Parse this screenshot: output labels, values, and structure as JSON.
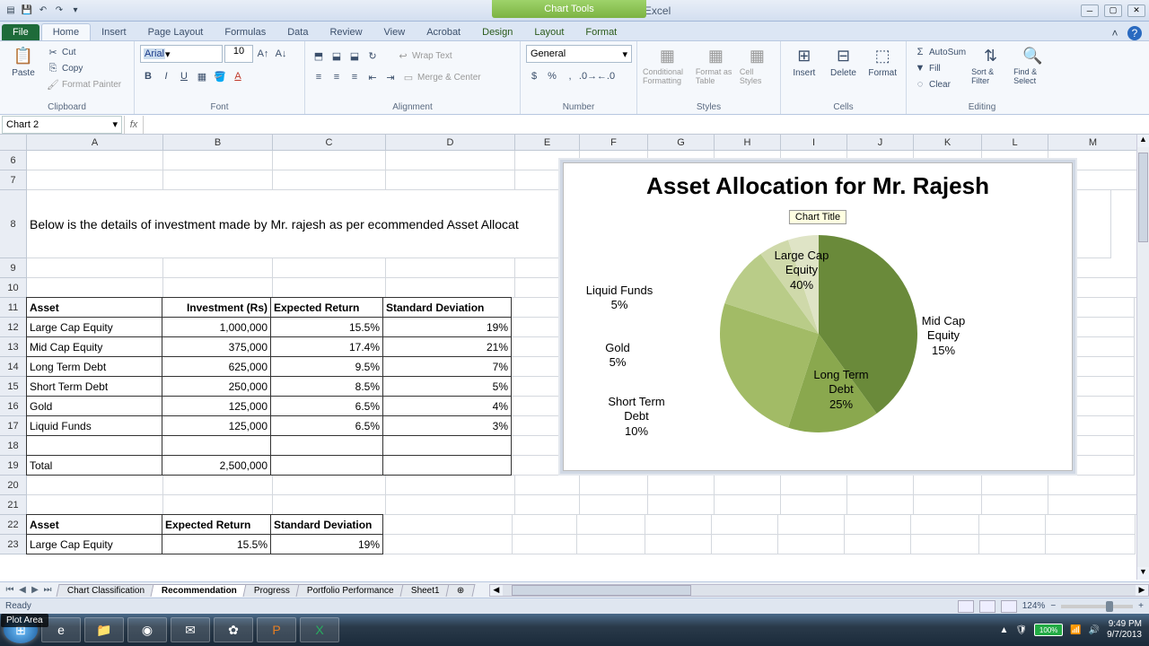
{
  "window": {
    "title": "Excel Webinar-Data - Microsoft Excel",
    "contextual_tab_group": "Chart Tools"
  },
  "qat": {
    "save": "💾",
    "undo": "↶",
    "redo": "↷",
    "more": "▾"
  },
  "tabs": {
    "file": "File",
    "home": "Home",
    "insert": "Insert",
    "page_layout": "Page Layout",
    "formulas": "Formulas",
    "data": "Data",
    "review": "Review",
    "view": "View",
    "acrobat": "Acrobat",
    "design": "Design",
    "layout": "Layout",
    "format": "Format"
  },
  "ribbon": {
    "clipboard": {
      "label": "Clipboard",
      "paste": "Paste",
      "cut": "Cut",
      "copy": "Copy",
      "fmtpainter": "Format Painter"
    },
    "font": {
      "label": "Font",
      "name": "Arial",
      "size": "10"
    },
    "alignment": {
      "label": "Alignment",
      "wrap": "Wrap Text",
      "merge": "Merge & Center"
    },
    "number": {
      "label": "Number",
      "format": "General"
    },
    "styles": {
      "label": "Styles",
      "cond": "Conditional Formatting",
      "table": "Format as Table",
      "cell": "Cell Styles"
    },
    "cells": {
      "label": "Cells",
      "insert": "Insert",
      "delete": "Delete",
      "format": "Format"
    },
    "editing": {
      "label": "Editing",
      "autosum": "AutoSum",
      "fill": "Fill",
      "clear": "Clear",
      "sort": "Sort & Filter",
      "find": "Find & Select"
    }
  },
  "namebox": "Chart 2",
  "fx": "fx",
  "columns": [
    "A",
    "B",
    "C",
    "D",
    "E",
    "F",
    "G",
    "H",
    "I",
    "J",
    "K",
    "L",
    "M"
  ],
  "rows_visible": [
    "6",
    "7",
    "8",
    "9",
    "10",
    "11",
    "12",
    "13",
    "14",
    "15",
    "16",
    "17",
    "18",
    "19",
    "20",
    "21",
    "22",
    "23"
  ],
  "sheet": {
    "intro": "Below is the details of investment made by Mr. rajesh as per ecommended Asset Allocat",
    "headers": {
      "asset": "Asset",
      "inv": "Investment (Rs)",
      "ret": "Expected Return",
      "std": "Standard Deviation"
    },
    "rows": [
      {
        "asset": "Large Cap Equity",
        "inv": "1,000,000",
        "ret": "15.5%",
        "std": "19%"
      },
      {
        "asset": "Mid Cap Equity",
        "inv": "375,000",
        "ret": "17.4%",
        "std": "21%"
      },
      {
        "asset": "Long Term Debt",
        "inv": "625,000",
        "ret": "9.5%",
        "std": "7%"
      },
      {
        "asset": "Short Term Debt",
        "inv": "250,000",
        "ret": "8.5%",
        "std": "5%"
      },
      {
        "asset": "Gold",
        "inv": "125,000",
        "ret": "6.5%",
        "std": "4%"
      },
      {
        "asset": "Liquid Funds",
        "inv": "125,000",
        "ret": "6.5%",
        "std": "3%"
      }
    ],
    "total": {
      "label": "Total",
      "inv": "2,500,000"
    },
    "headers2": {
      "asset": "Asset",
      "ret": "Expected Return",
      "std": "Standard Deviation"
    },
    "row2_0": {
      "asset": "Large Cap Equity",
      "ret": "15.5%",
      "std": "19%"
    }
  },
  "chart": {
    "title": "Asset Allocation for Mr. Rajesh",
    "tooltip": "Chart Title",
    "labels": {
      "large": "Large Cap\nEquity\n40%",
      "mid": "Mid Cap\nEquity\n15%",
      "long": "Long Term\nDebt\n25%",
      "short": "Short Term\nDebt\n10%",
      "gold": "Gold\n5%",
      "liquid": "Liquid Funds\n5%"
    }
  },
  "chart_data": {
    "type": "pie",
    "title": "Asset Allocation for Mr. Rajesh",
    "categories": [
      "Large Cap Equity",
      "Mid Cap Equity",
      "Long Term Debt",
      "Short Term Debt",
      "Gold",
      "Liquid Funds"
    ],
    "values": [
      40,
      15,
      25,
      10,
      5,
      5
    ],
    "colors": [
      "#6a8a3a",
      "#8aa84e",
      "#a2bb66",
      "#b9cc88",
      "#cfd9aa",
      "#dfe4c6"
    ]
  },
  "sheets": {
    "s1": "Chart Classification",
    "s2": "Recommendation",
    "s3": "Progress",
    "s4": "Portfolio Performance",
    "s5": "Sheet1"
  },
  "status": {
    "ready": "Ready",
    "zoom": "124%"
  },
  "taskbar": {
    "battery": "100%",
    "time": "9:49 PM",
    "date": "9/7/2013"
  },
  "yt_tooltip": "Plot Area"
}
